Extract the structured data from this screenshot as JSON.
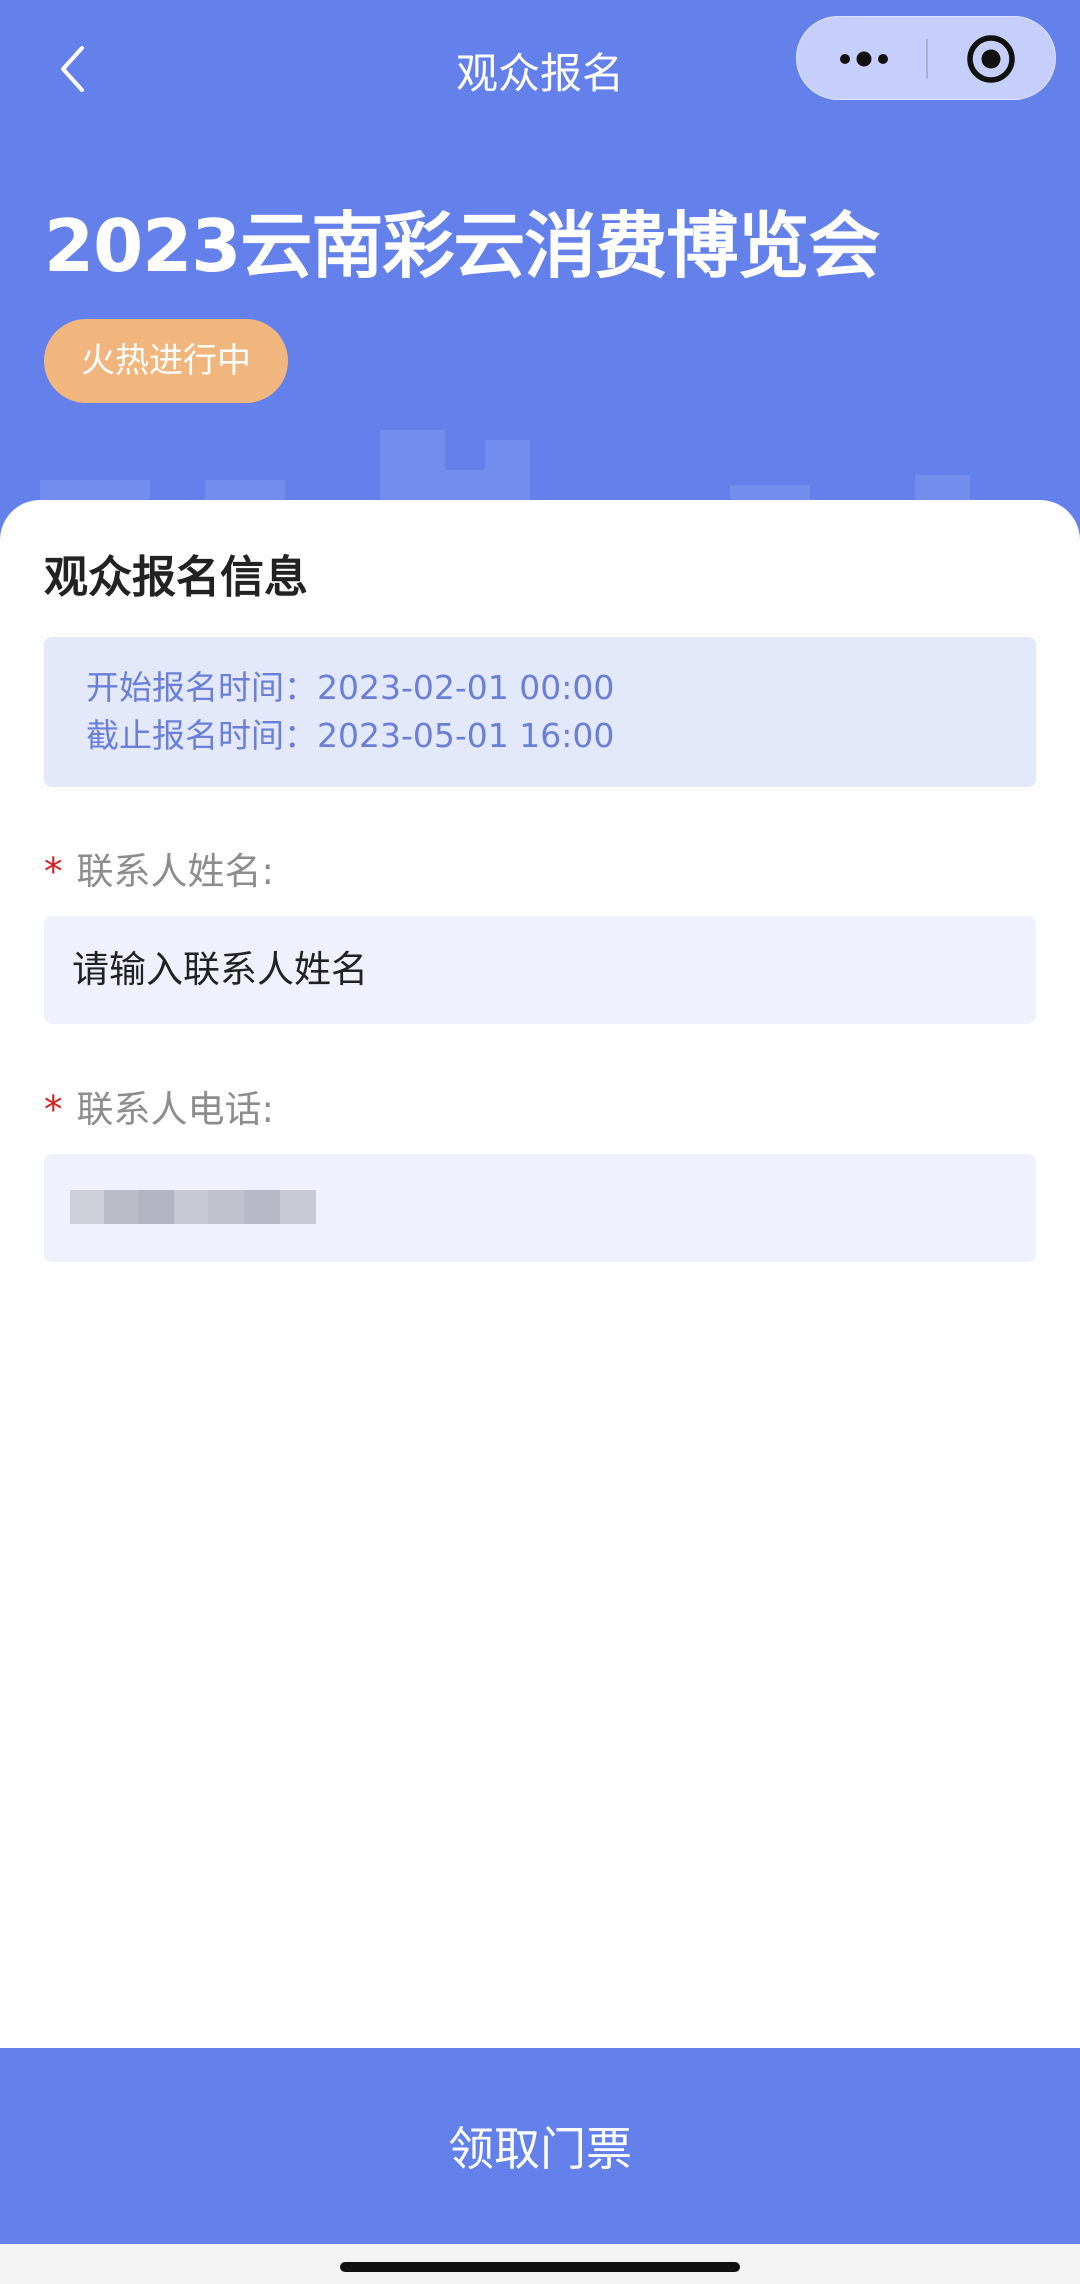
{
  "nav": {
    "title": "观众报名",
    "back_icon": "chevron-left-icon",
    "more_icon": "more-dots-icon",
    "close_icon": "target-circle-icon"
  },
  "hero": {
    "event_title": "2023云南彩云消费博览会",
    "status_badge": "火热进行中"
  },
  "form": {
    "section_title": "观众报名信息",
    "start_time": "开始报名时间：2023-02-01 00:00",
    "end_time": "截止报名时间：2023-05-01 16:00",
    "required_mark": "*",
    "name_label": "联系人姓名:",
    "name_placeholder": "请输入联系人姓名",
    "phone_label": "联系人电话:"
  },
  "footer": {
    "submit_label": "领取门票"
  },
  "colors": {
    "primary": "#6480ea",
    "badge": "#f0b67d",
    "info_bg": "#e3e8fb",
    "input_bg": "#eff2fe",
    "required": "#d42020"
  }
}
